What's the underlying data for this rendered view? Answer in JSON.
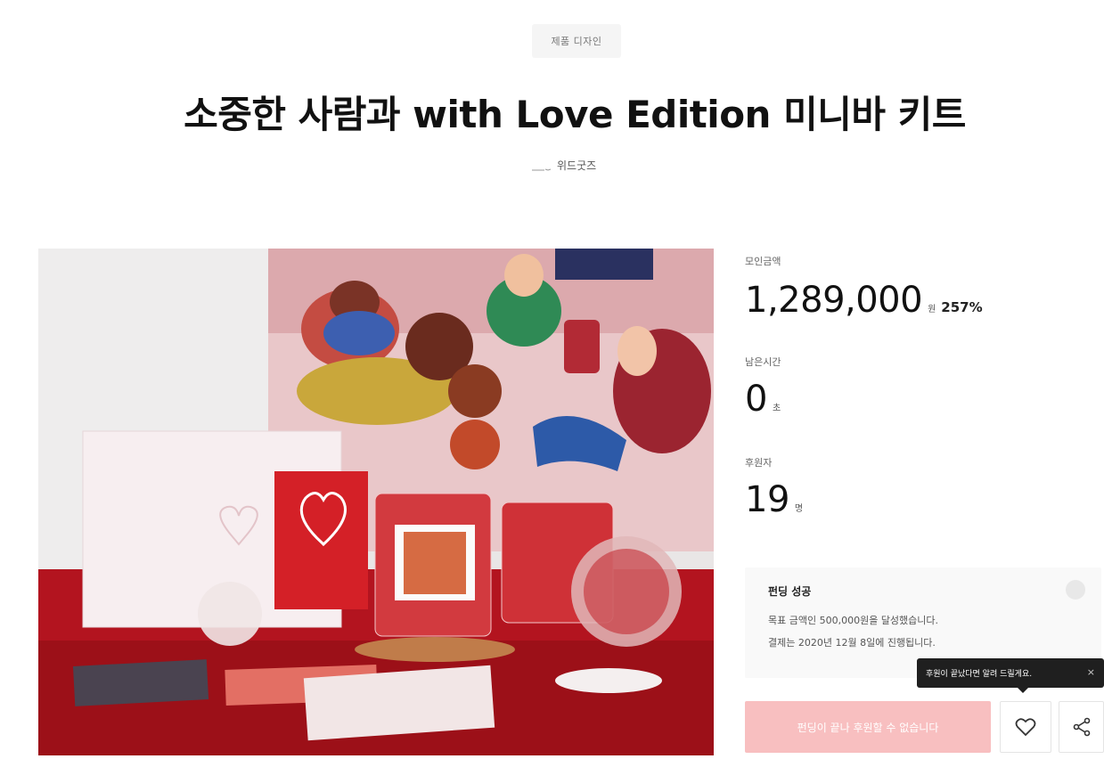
{
  "header": {
    "category": "제품 디자인",
    "title": "소중한 사람과 with Love Edition 미니바 키트",
    "creator": "위드굿즈"
  },
  "stats": {
    "amount_label": "모인금액",
    "amount_value": "1,289,000",
    "amount_unit": "원",
    "amount_percent": "257%",
    "time_label": "남은시간",
    "time_value": "0",
    "time_unit": "초",
    "backers_label": "후원자",
    "backers_value": "19",
    "backers_unit": "명"
  },
  "funding": {
    "title": "펀딩 성공",
    "line1": "목표 금액인 500,000원을 달성했습니다.",
    "line2": "결제는 2020년 12월 8일에 진행됩니다."
  },
  "tooltip": {
    "text": "후원이 끝났다면 알려 드릴게요.",
    "close": "×"
  },
  "actions": {
    "cta_label": "펀딩이 끝나 후원할 수 없습니다",
    "like_icon": "heart-icon",
    "share_icon": "share-icon"
  },
  "colors": {
    "cta_bg": "#f8bfc0",
    "tooltip_bg": "#1f1f1f",
    "accent_red": "#c0202a"
  }
}
